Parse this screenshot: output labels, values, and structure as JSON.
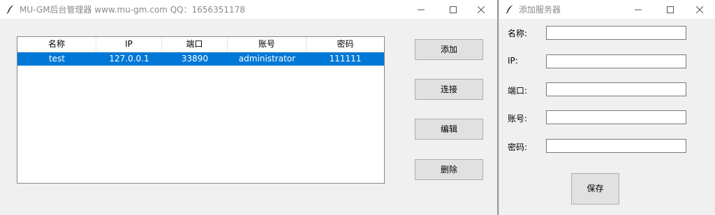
{
  "main_window": {
    "title": "MU-GM后台管理器  www.mu-gm.com  QQ：1656351178",
    "icon": "feather-icon",
    "controls": [
      "minimize-icon",
      "maximize-icon",
      "close-icon"
    ]
  },
  "server_table": {
    "columns": [
      "名称",
      "IP",
      "端口",
      "账号",
      "密码"
    ],
    "rows": [
      {
        "name": "test",
        "ip": "127.0.0.1",
        "port": "33890",
        "account": "administrator",
        "password": "111111",
        "selected": true
      }
    ],
    "selection_color": "#0078d7"
  },
  "actions": {
    "add": "添加",
    "connect": "连接",
    "edit": "编辑",
    "delete": "删除"
  },
  "add_window": {
    "title": "添加服务器",
    "icon": "feather-icon",
    "fields": {
      "name": {
        "label": "名称:",
        "value": ""
      },
      "ip": {
        "label": "IP:",
        "value": ""
      },
      "port": {
        "label": "端口:",
        "value": ""
      },
      "account": {
        "label": "账号:",
        "value": ""
      },
      "password": {
        "label": "密码:",
        "value": ""
      }
    },
    "save": "保存"
  }
}
